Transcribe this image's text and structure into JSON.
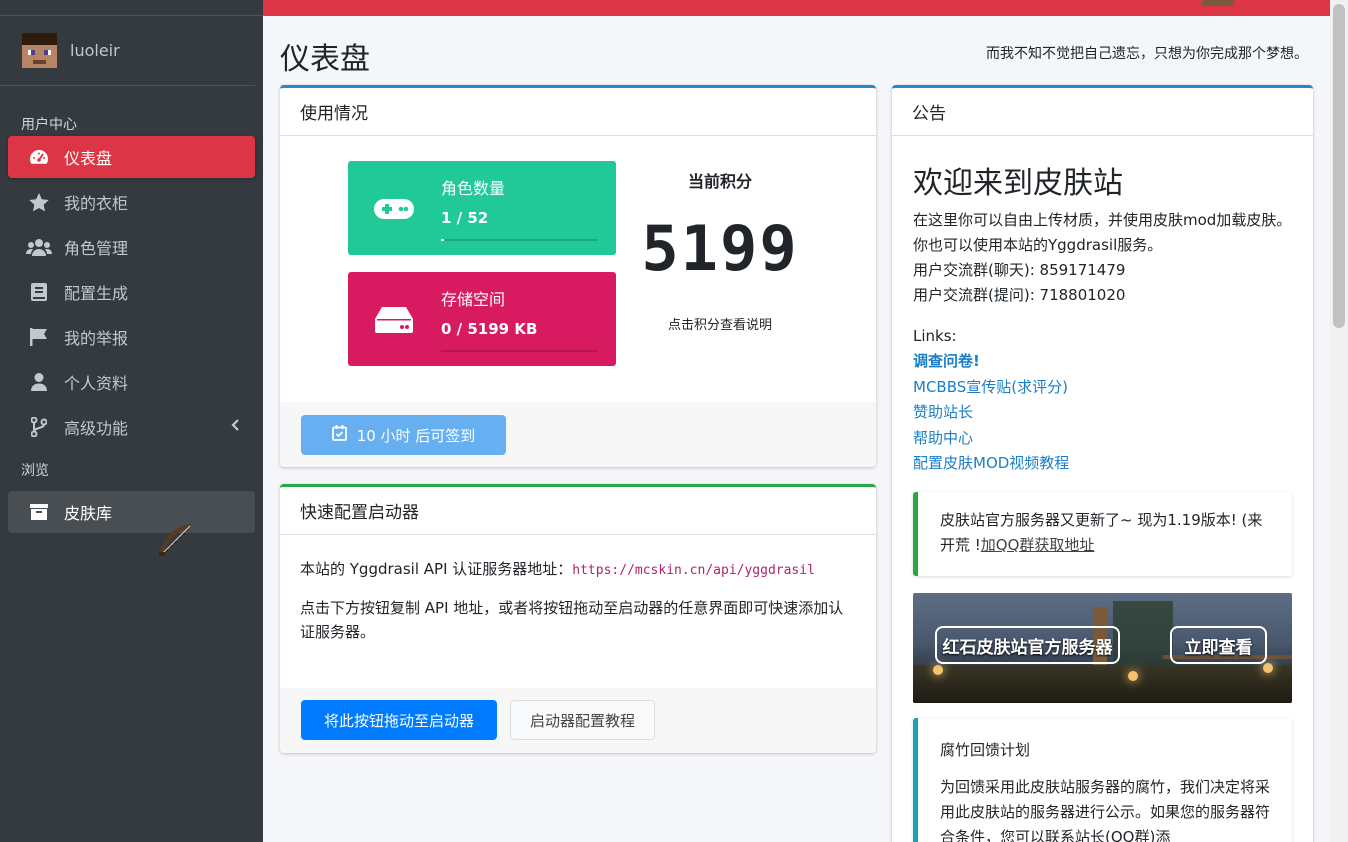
{
  "sidebar": {
    "username": "luoleir",
    "header_user": "用户中心",
    "header_browse": "浏览",
    "items": [
      {
        "label": "仪表盘",
        "icon": "dashboard-icon"
      },
      {
        "label": "我的衣柜",
        "icon": "star-icon"
      },
      {
        "label": "角色管理",
        "icon": "users-icon"
      },
      {
        "label": "配置生成",
        "icon": "book-icon"
      },
      {
        "label": "我的举报",
        "icon": "flag-icon"
      },
      {
        "label": "个人资料",
        "icon": "user-icon"
      },
      {
        "label": "高级功能",
        "icon": "branch-icon"
      }
    ],
    "browse_items": [
      {
        "label": "皮肤库",
        "icon": "archive-icon"
      }
    ],
    "colors": {
      "background": "#343a40",
      "active": "#dc3545"
    }
  },
  "page": {
    "title": "仪表盘",
    "motto": "而我不知不觉把自己遗忘，只想为你完成那个梦想。"
  },
  "usage": {
    "header": "使用情况",
    "players": {
      "label": "角色数量",
      "value": "1 / 52",
      "progress": 0.019,
      "icon": "gamepad-icon",
      "color": "#20c997"
    },
    "storage": {
      "label": "存储空间",
      "value": "0 / 5199 KB",
      "progress": 0.0,
      "icon": "hdd-icon",
      "color": "#d81b60"
    },
    "score_title": "当前积分",
    "score": "5199",
    "score_note": "点击积分查看说明",
    "checkin_label": "10 小时 后可签到"
  },
  "launcher": {
    "header": "快速配置启动器",
    "api_text": "本站的 Yggdrasil API 认证服务器地址：",
    "api_url": "https://mcskin.cn/api/yggdrasil",
    "help_text": "点击下方按钮复制 API 地址，或者将按钮拖动至启动器的任意界面即可快速添加认证服务器。",
    "drag_button": "将此按钮拖动至启动器",
    "tutorial_button": "启动器配置教程"
  },
  "notice": {
    "header": "公告",
    "title": "欢迎来到皮肤站",
    "intro": "在这里你可以自由上传材质，并使用皮肤mod加载皮肤。你也可以使用本站的Yggdrasil服务。",
    "group_chat": "用户交流群(聊天): 859171479",
    "group_qa": "用户交流群(提问): 718801020",
    "links_label": "Links:",
    "links": [
      {
        "label": "调查问卷!",
        "bold": true
      },
      {
        "label": "MCBBS宣传贴(求评分)",
        "bold": false
      },
      {
        "label": "赞助站长",
        "bold": false
      },
      {
        "label": "帮助中心",
        "bold": false
      },
      {
        "label": "配置皮肤MOD视频教程",
        "bold": false
      }
    ],
    "callout_text": "皮肤站官方服务器又更新了~ 现为1.19版本! (来开荒 !",
    "callout_link": "加QQ群获取地址",
    "banner_left": "红石皮肤站官方服务器",
    "banner_right": "立即查看",
    "plan_title": "腐竹回馈计划",
    "plan_text": "为回馈采用此皮肤站服务器的腐竹，我们决定将采用此皮肤站的服务器进行公示。如果您的服务器符合条件，您可以联系站长(QQ群)添"
  }
}
